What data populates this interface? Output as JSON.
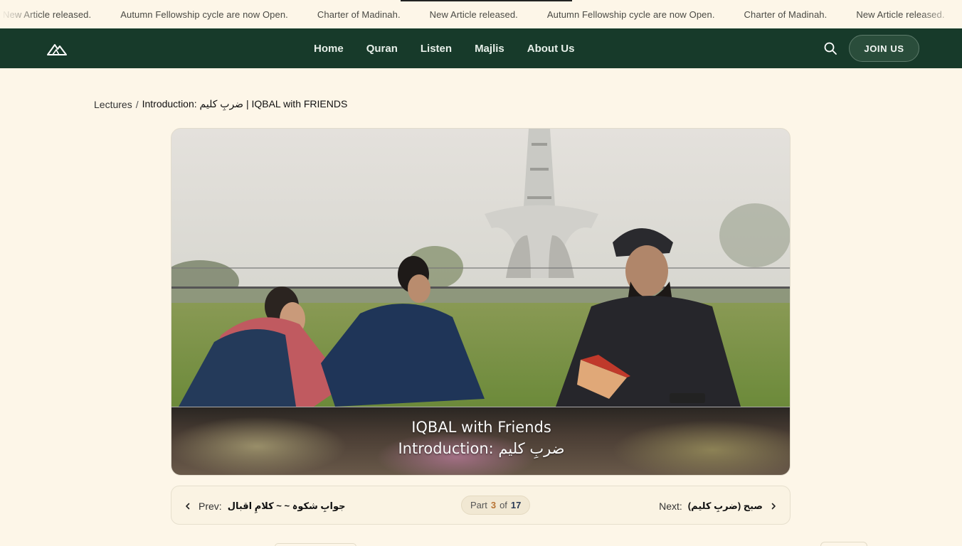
{
  "ticker": {
    "items": [
      "New Article released.",
      "Autumn Fellowship cycle are now Open.",
      "Charter of Madinah.",
      "New Article released.",
      "Autumn Fellowship cycle are now Open.",
      "Charter of Madinah.",
      "New Article released."
    ]
  },
  "nav": {
    "links": [
      "Home",
      "Quran",
      "Listen",
      "Majlis",
      "About Us"
    ],
    "join_label": "JOIN US",
    "logo_icon": "mountain-logo-icon",
    "search_icon": "search-icon"
  },
  "breadcrumb": {
    "parent": "Lectures",
    "separator": "/",
    "current": "Introduction: ضربِ کلیم | IQBAL with FRIENDS"
  },
  "video": {
    "caption_line1": "IQBAL with Friends",
    "caption_line2": "Introduction: ضربِ کلیم"
  },
  "pager": {
    "prev_label": "Prev:",
    "prev_title": "جوابِ شکوہ ~ ~ کلامِ اقبال",
    "part_label": "Part",
    "part_current": "3",
    "part_of": "of",
    "part_total": "17",
    "next_label": "Next:",
    "next_title": "صبح (ضربِ کلیم)"
  },
  "colors": {
    "nav_bg": "#173a2a",
    "page_bg": "#fdf6e8",
    "accent_part": "#b87333"
  }
}
